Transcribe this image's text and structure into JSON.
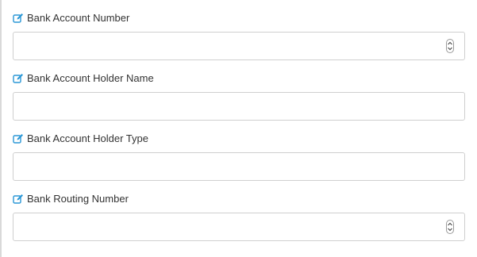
{
  "form": {
    "fields": [
      {
        "label": "Bank Account Number",
        "value": "",
        "input_type": "number",
        "icon": "edit-icon"
      },
      {
        "label": "Bank Account Holder Name",
        "value": "",
        "input_type": "text",
        "icon": "edit-icon"
      },
      {
        "label": "Bank Account Holder Type",
        "value": "",
        "input_type": "text",
        "icon": "edit-icon"
      },
      {
        "label": "Bank Routing Number",
        "value": "",
        "input_type": "number",
        "icon": "edit-icon"
      }
    ]
  },
  "colors": {
    "icon_accent": "#2a97d6",
    "border": "#cfcfcf",
    "text": "#333333"
  }
}
